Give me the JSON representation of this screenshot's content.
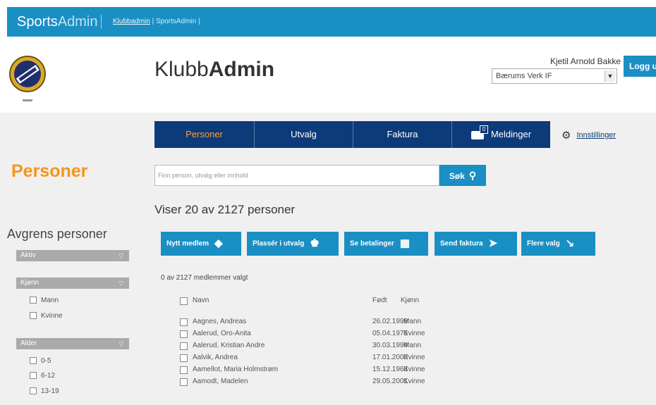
{
  "topbar": {
    "brand_sports": "Sports",
    "brand_admin": "Admin",
    "crumb_link": "Klubbadmin",
    "crumb_current": "| SportsAdmin |"
  },
  "header": {
    "app_title_plain": "Klubb",
    "app_title_bold": "Admin",
    "username": "Kjetil Arnold Bakke",
    "club_select_value": "Bærums Verk IF",
    "logout_label": "Logg ut"
  },
  "nav": {
    "items": [
      {
        "label": "Personer",
        "active": true
      },
      {
        "label": "Utvalg",
        "active": false
      },
      {
        "label": "Faktura",
        "active": false
      },
      {
        "label": "Meldinger",
        "active": false,
        "icon": "message-icon",
        "badge": "0"
      }
    ],
    "settings_label": "Innstillinger",
    "settings_icon": "gear-icon"
  },
  "sidebar": {
    "heading": "Personer",
    "filter_title": "Avgrens personer",
    "facets": [
      {
        "label": "Aktiv",
        "options": []
      },
      {
        "label": "Kjønn",
        "options": [
          "Mann",
          "Kvinne"
        ]
      },
      {
        "label": "Alder",
        "options": [
          "0-5",
          "6-12",
          "13-19"
        ]
      }
    ]
  },
  "search": {
    "placeholder": "Finn person, utvalg eller innhold",
    "button_label": "Søk"
  },
  "result_count": "Viser 20 av 2127 personer",
  "actions": [
    {
      "label": "Nytt medlem",
      "icon": "tag-icon"
    },
    {
      "label": "Plassér i utvalg",
      "icon": "group-icon"
    },
    {
      "label": "Se betalinger",
      "icon": "payments-icon"
    },
    {
      "label": "Send faktura",
      "icon": "send-invoice-icon"
    },
    {
      "label": "Flere valg",
      "icon": "arrow-down-right-icon"
    }
  ],
  "selected_info": "0 av 2127 medlemmer valgt",
  "table": {
    "columns": [
      "Navn",
      "Født",
      "Kjønn"
    ],
    "rows": [
      {
        "name": "Aagnes, Andreas",
        "born": "26.02.1998",
        "gender": "Mann"
      },
      {
        "name": "Aalerud, Oro-Anita",
        "born": "05.04.1975",
        "gender": "Kvinne"
      },
      {
        "name": "Aalerud, Kristian Andre",
        "born": "30.03.1994",
        "gender": "Mann"
      },
      {
        "name": "Aalvik, Andrea",
        "born": "17.01.2000",
        "gender": "Kvinne"
      },
      {
        "name": "Aamellot, Maria Holmstrøm",
        "born": "15.12.1963",
        "gender": "Kvinne"
      },
      {
        "name": "Aamodt, Madelen",
        "born": "29.05.2001",
        "gender": "Kvinne"
      }
    ]
  },
  "colors": {
    "accent_blue": "#1a8fc4",
    "nav_navy": "#0d3a78",
    "heading_orange": "#f7941d"
  }
}
